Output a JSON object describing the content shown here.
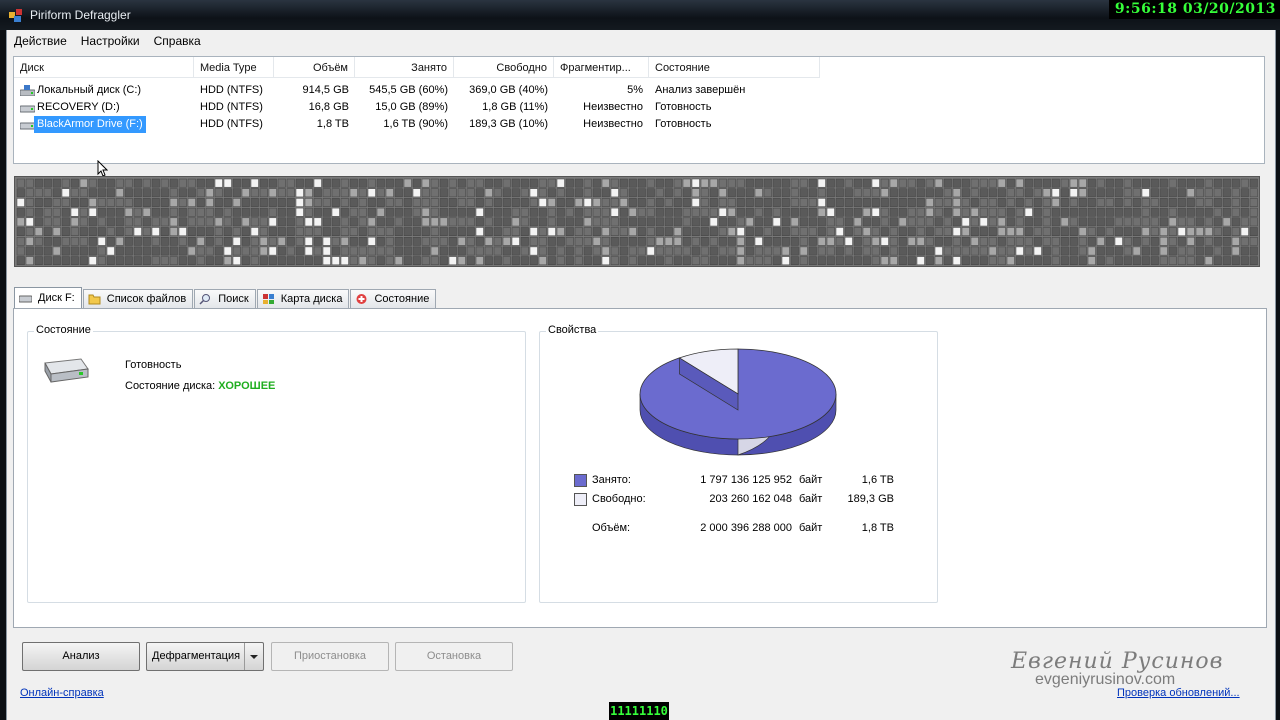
{
  "app": {
    "title": "Piriform Defraggler",
    "clock": "9:56:18  03/20/2013",
    "icon": "defraggler-app-icon"
  },
  "menu": [
    "Действие",
    "Настройки",
    "Справка"
  ],
  "drive_list": {
    "columns": [
      "Диск",
      "Media Type",
      "Объём",
      "Занято",
      "Свободно",
      "Фрагментир...",
      "Состояние"
    ],
    "rows": [
      {
        "name": "Локальный диск (C:)",
        "media": "HDD (NTFS)",
        "size": "914,5 GB",
        "used": "545,5 GB (60%)",
        "free": "369,0 GB (40%)",
        "frag": "5%",
        "status": "Анализ завершён",
        "icon": "system-drive-icon",
        "selected": false
      },
      {
        "name": "RECOVERY (D:)",
        "media": "HDD (NTFS)",
        "size": "16,8 GB",
        "used": "15,0 GB (89%)",
        "free": "1,8 GB (11%)",
        "frag": "Неизвестно",
        "status": "Готовность",
        "icon": "hard-drive-icon",
        "selected": false
      },
      {
        "name": "BlackArmor Drive (F:)",
        "media": "HDD (NTFS)",
        "size": "1,8 TB",
        "used": "1,6 TB (90%)",
        "free": "189,3 GB (10%)",
        "frag": "Неизвестно",
        "status": "Готовность",
        "icon": "hard-drive-icon",
        "selected": true
      }
    ]
  },
  "tabs": [
    {
      "label": "Диск F:",
      "icon": "drive-icon",
      "active": true
    },
    {
      "label": "Список файлов",
      "icon": "folder-icon",
      "active": false
    },
    {
      "label": "Поиск",
      "icon": "magnifier-icon",
      "active": false
    },
    {
      "label": "Карта диска",
      "icon": "disk-map-icon",
      "active": false
    },
    {
      "label": "Состояние",
      "icon": "health-icon",
      "active": false
    }
  ],
  "status_group": {
    "title": "Состояние",
    "ready": "Готовность",
    "health_label": "Состояние диска:",
    "health_value": "ХОРОШЕЕ"
  },
  "properties_group": {
    "title": "Свойства",
    "used_fraction": 0.898,
    "used_color": "#6b6bcf",
    "free_color": "#eeeef8",
    "legend": [
      {
        "label": "Занято:",
        "bytes": "1 797 136 125 952",
        "unit": "байт",
        "human": "1,6 TB",
        "color": "#6b6bcf"
      },
      {
        "label": "Свободно:",
        "bytes": "203 260 162 048",
        "unit": "байт",
        "human": "189,3 GB",
        "color": "#eeeef8"
      },
      {
        "label": "Объём:",
        "bytes": "2 000 396 288 000",
        "unit": "байт",
        "human": "1,8 TB"
      }
    ]
  },
  "buttons": {
    "analyze": "Анализ",
    "defrag": "Дефрагментация",
    "pause": "Приостановка",
    "stop": "Остановка"
  },
  "footer": {
    "help_link": "Онлайн-справка",
    "update_link": "Проверка обновлений..."
  },
  "overlay": {
    "author": "Евгений Русинов",
    "site": "evgeniyrusinov.com",
    "binary": "11111110"
  }
}
